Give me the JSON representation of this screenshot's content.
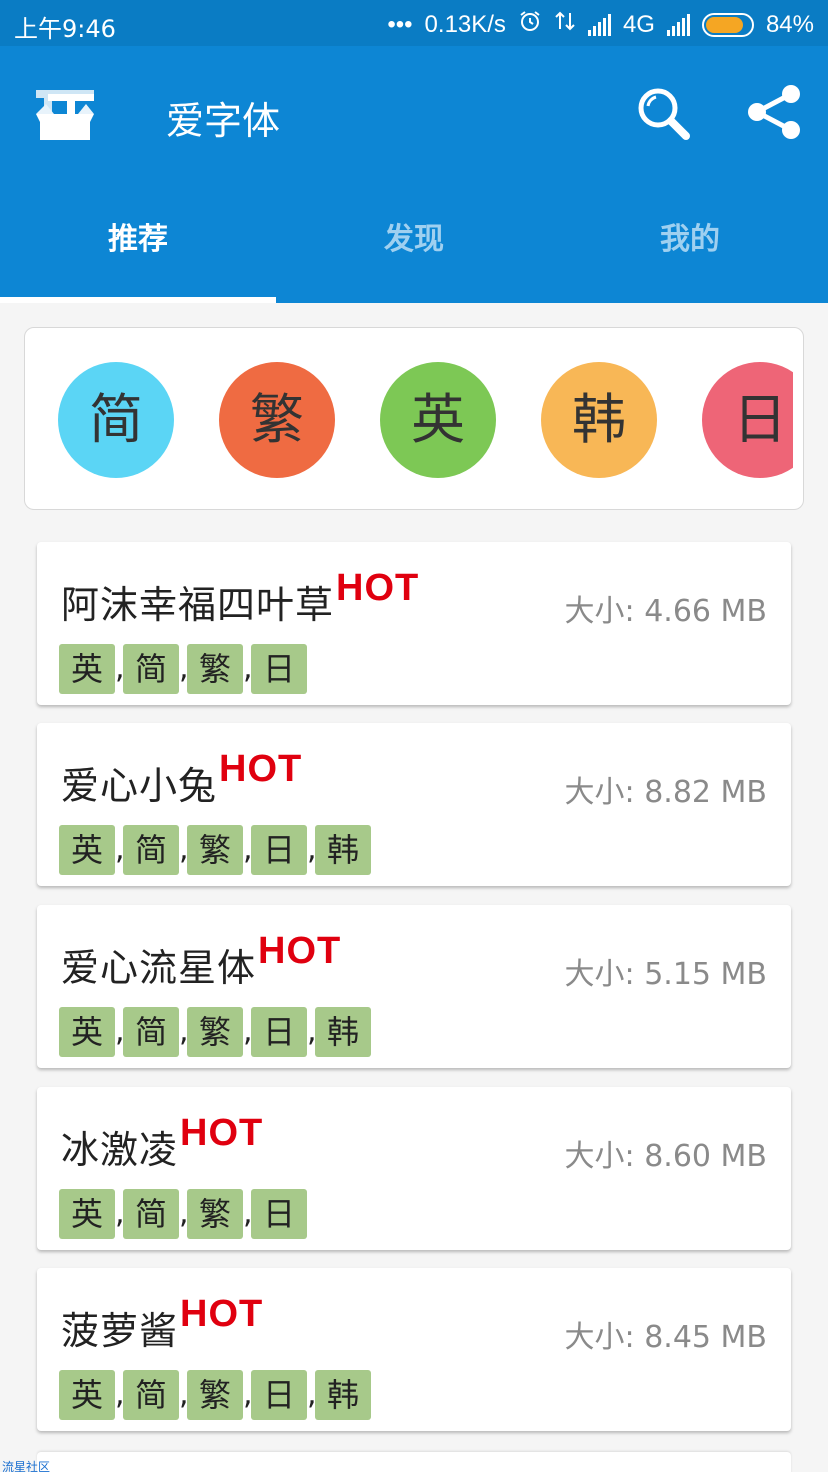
{
  "status_bar": {
    "time": "上午9:46",
    "dots": "•••",
    "speed": "0.13K/s",
    "network": "4G",
    "battery": "84%",
    "battery_fraction": 0.84
  },
  "app_bar": {
    "title": "爱字体",
    "icons": [
      "logo-icon",
      "search-icon",
      "share-icon"
    ]
  },
  "tabs": [
    {
      "label": "推荐",
      "active": true
    },
    {
      "label": "发现",
      "active": false
    },
    {
      "label": "我的",
      "active": false
    }
  ],
  "languages": [
    {
      "label": "简",
      "color": "#5bd5f5"
    },
    {
      "label": "繁",
      "color": "#ef6b42"
    },
    {
      "label": "英",
      "color": "#7dc855"
    },
    {
      "label": "韩",
      "color": "#f8b756"
    },
    {
      "label": "日",
      "color": "#ee6577"
    }
  ],
  "fonts": [
    {
      "name": "阿沫幸福四叶草",
      "hot": "HOT",
      "size": "大小: 4.66 MB",
      "tags": [
        "英",
        "简",
        "繁",
        "日"
      ]
    },
    {
      "name": "爱心小兔",
      "hot": "HOT",
      "size": "大小: 8.82 MB",
      "tags": [
        "英",
        "简",
        "繁",
        "日",
        "韩"
      ]
    },
    {
      "name": "爱心流星体",
      "hot": "HOT",
      "size": "大小: 5.15 MB",
      "tags": [
        "英",
        "简",
        "繁",
        "日",
        "韩"
      ]
    },
    {
      "name": "冰激凌",
      "hot": "HOT",
      "size": "大小: 8.60 MB",
      "tags": [
        "英",
        "简",
        "繁",
        "日"
      ]
    },
    {
      "name": "菠萝酱",
      "hot": "HOT",
      "size": "大小: 8.45 MB",
      "tags": [
        "英",
        "简",
        "繁",
        "日",
        "韩"
      ]
    }
  ],
  "tag_separator": ",",
  "watermark": "流星社区"
}
